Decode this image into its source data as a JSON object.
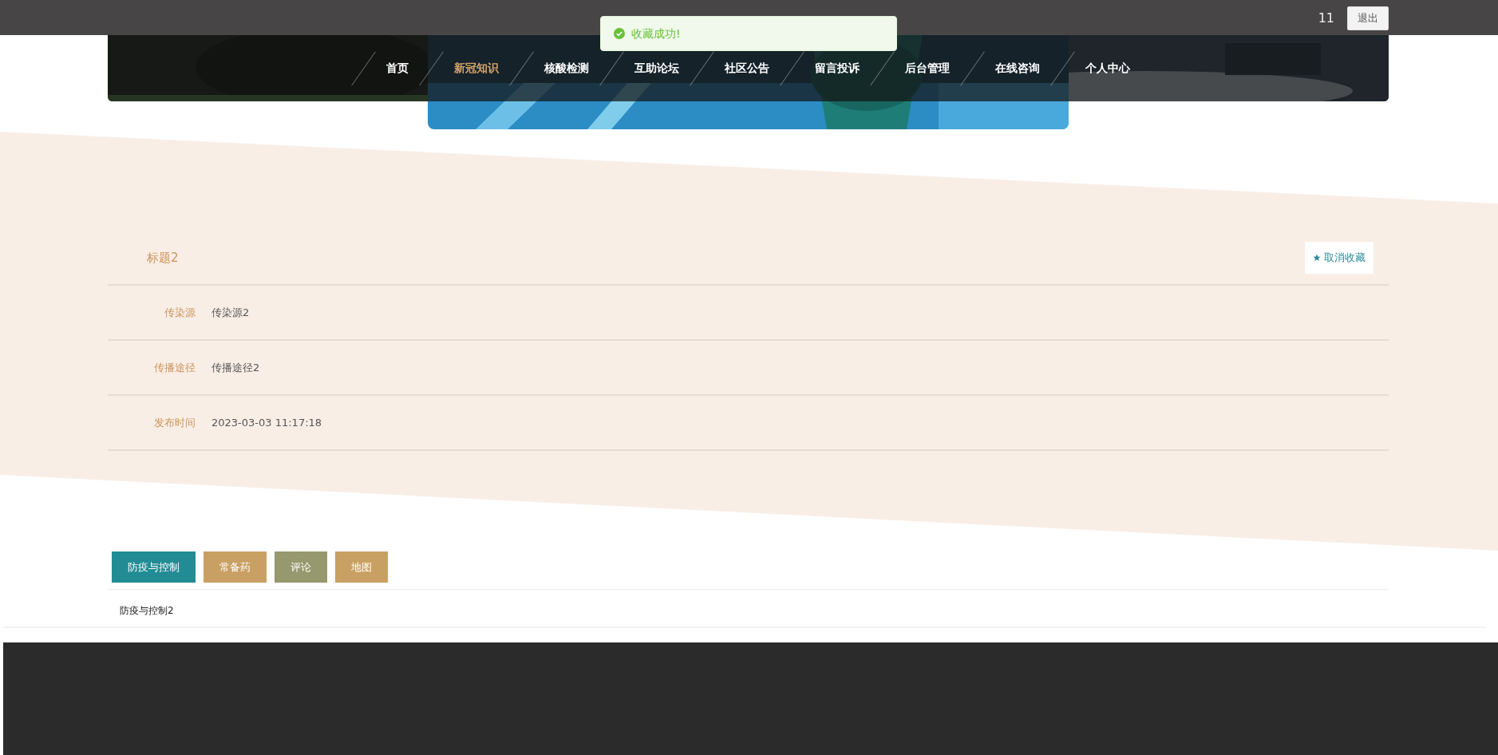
{
  "header": {
    "user": "11",
    "logout": "退出"
  },
  "toast": {
    "message": "收藏成功!"
  },
  "nav": [
    {
      "label": "首页",
      "selected": false
    },
    {
      "label": "新冠知识",
      "selected": true
    },
    {
      "label": "核酸检测",
      "selected": false
    },
    {
      "label": "互助论坛",
      "selected": false
    },
    {
      "label": "社区公告",
      "selected": false
    },
    {
      "label": "留言投诉",
      "selected": false
    },
    {
      "label": "后台管理",
      "selected": false
    },
    {
      "label": "在线咨询",
      "selected": false
    },
    {
      "label": "个人中心",
      "selected": false
    }
  ],
  "detail": {
    "title": "标题2",
    "favorite_button": "取消收藏",
    "fields": [
      {
        "label": "传染源",
        "value": "传染源2"
      },
      {
        "label": "传播途径",
        "value": "传播途径2"
      },
      {
        "label": "发布时间",
        "value": "2023-03-03 11:17:18"
      }
    ]
  },
  "tabs": [
    {
      "label": "防疫与控制",
      "selected": true,
      "hovered": false
    },
    {
      "label": "常备药",
      "selected": false,
      "hovered": false
    },
    {
      "label": "评论",
      "selected": false,
      "hovered": true
    },
    {
      "label": "地图",
      "selected": false,
      "hovered": false
    }
  ],
  "tab_content": "防疫与控制2"
}
